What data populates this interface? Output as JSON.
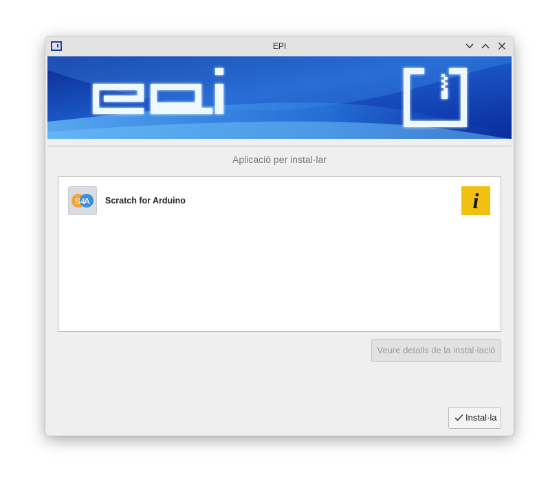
{
  "window": {
    "title": "EPI",
    "controls": [
      "minimize-chevron-down",
      "maximize-chevron-up",
      "close-x"
    ]
  },
  "banner": {
    "brand_text": "epi",
    "colors": {
      "dark_blue": "#0a2c9a",
      "mid_blue": "#1f67d6",
      "glow": "#e8f6ff"
    }
  },
  "main": {
    "subtitle": "Aplicació per instal·lar",
    "apps": [
      {
        "name": "Scratch for Arduino",
        "logo_letters": [
          "S4",
          "A"
        ]
      }
    ],
    "info_icon_glyph": "i",
    "details_button": "Veure detalls de la instal·lació",
    "install_button": "Instal·la"
  }
}
